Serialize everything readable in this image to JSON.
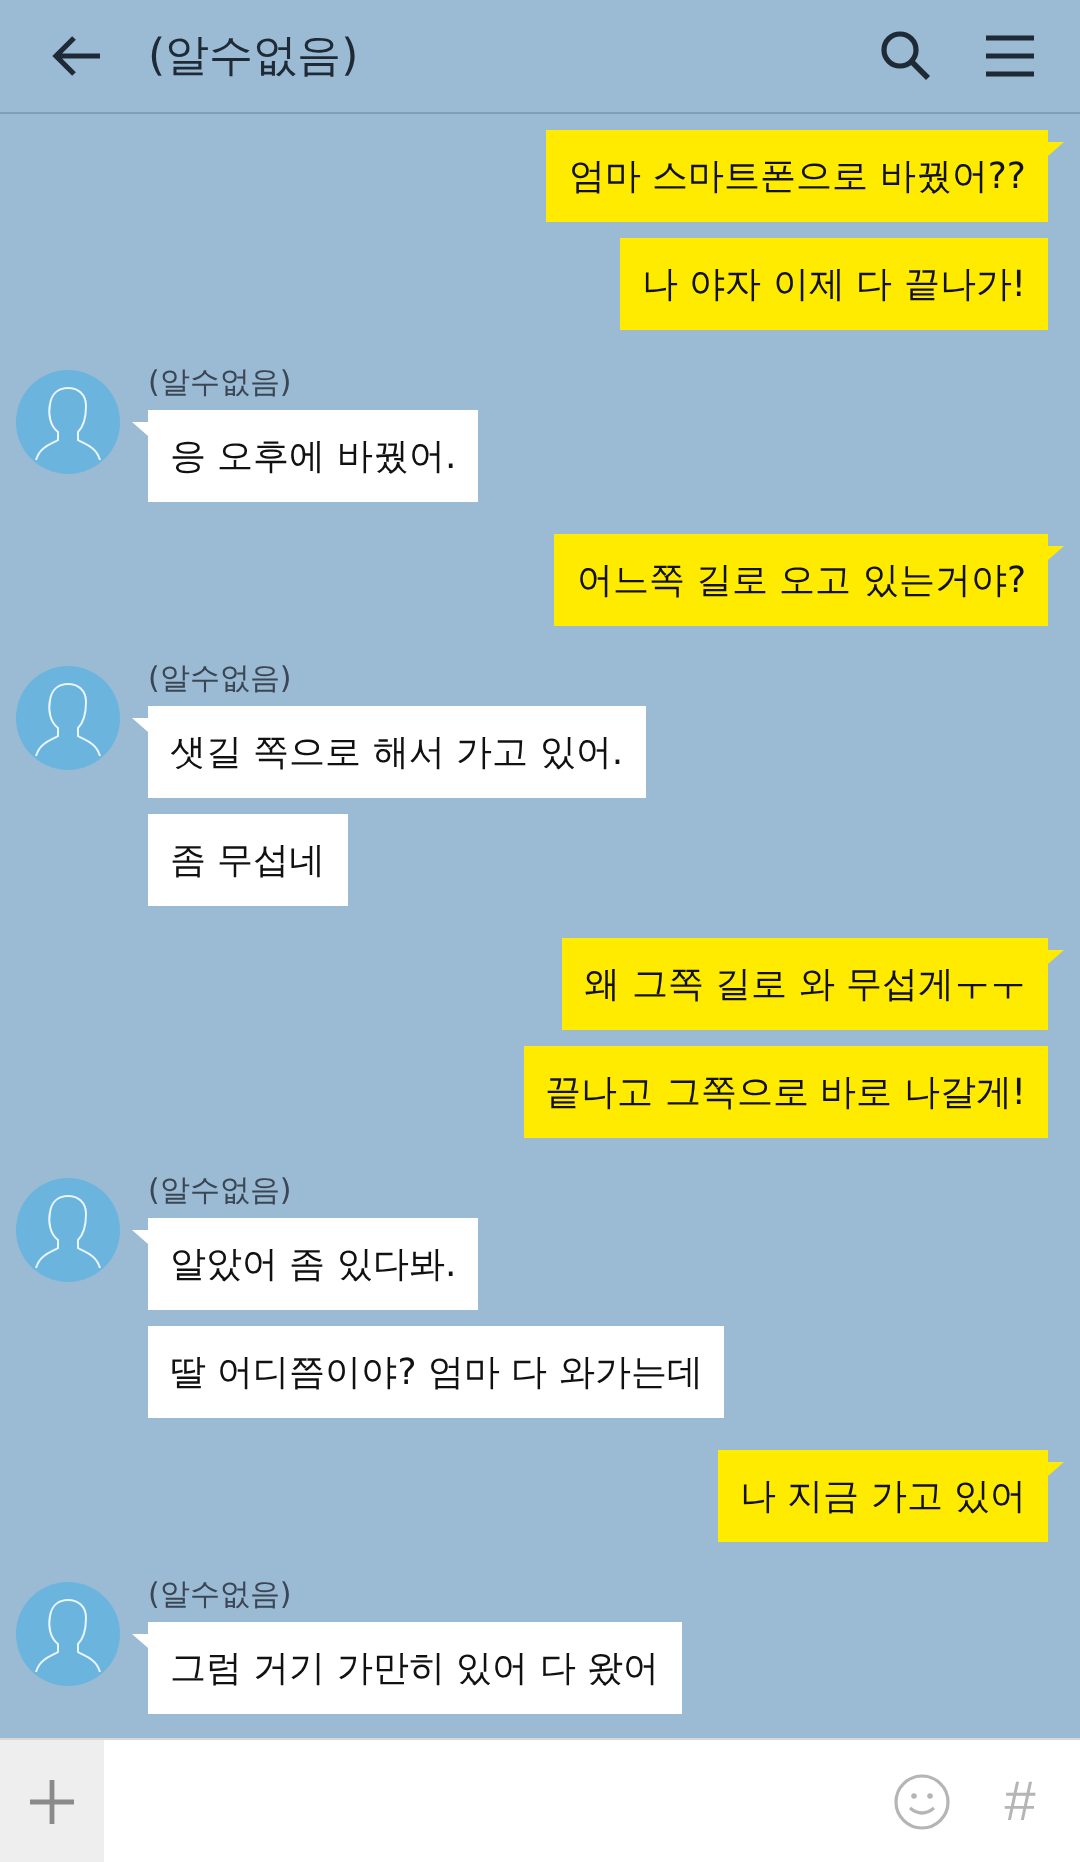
{
  "header": {
    "title": "(알수없음)"
  },
  "groups": [
    {
      "kind": "sent",
      "bubbles": [
        "엄마 스마트폰으로 바꿨어??",
        "나 야자 이제 다 끝나가!"
      ]
    },
    {
      "kind": "received",
      "sender": "(알수없음)",
      "bubbles": [
        "응 오후에 바꿨어."
      ]
    },
    {
      "kind": "sent",
      "bubbles": [
        "어느쪽 길로 오고 있는거야?"
      ]
    },
    {
      "kind": "received",
      "sender": "(알수없음)",
      "bubbles": [
        "샛길 쪽으로 해서 가고 있어.",
        "좀 무섭네"
      ]
    },
    {
      "kind": "sent",
      "bubbles": [
        "왜 그쪽 길로 와 무섭게ㅜㅜ",
        "끝나고 그쪽으로 바로 나갈게!"
      ]
    },
    {
      "kind": "received",
      "sender": "(알수없음)",
      "bubbles": [
        "알았어 좀 있다봐.",
        "딸 어디쯤이야? 엄마 다 와가는데"
      ]
    },
    {
      "kind": "sent",
      "bubbles": [
        "나 지금 가고 있어"
      ]
    },
    {
      "kind": "received",
      "sender": "(알수없음)",
      "bubbles": [
        "그럼 거기 가만히 있어 다 왔어"
      ]
    }
  ],
  "input_bar": {
    "hash_button": "#"
  }
}
